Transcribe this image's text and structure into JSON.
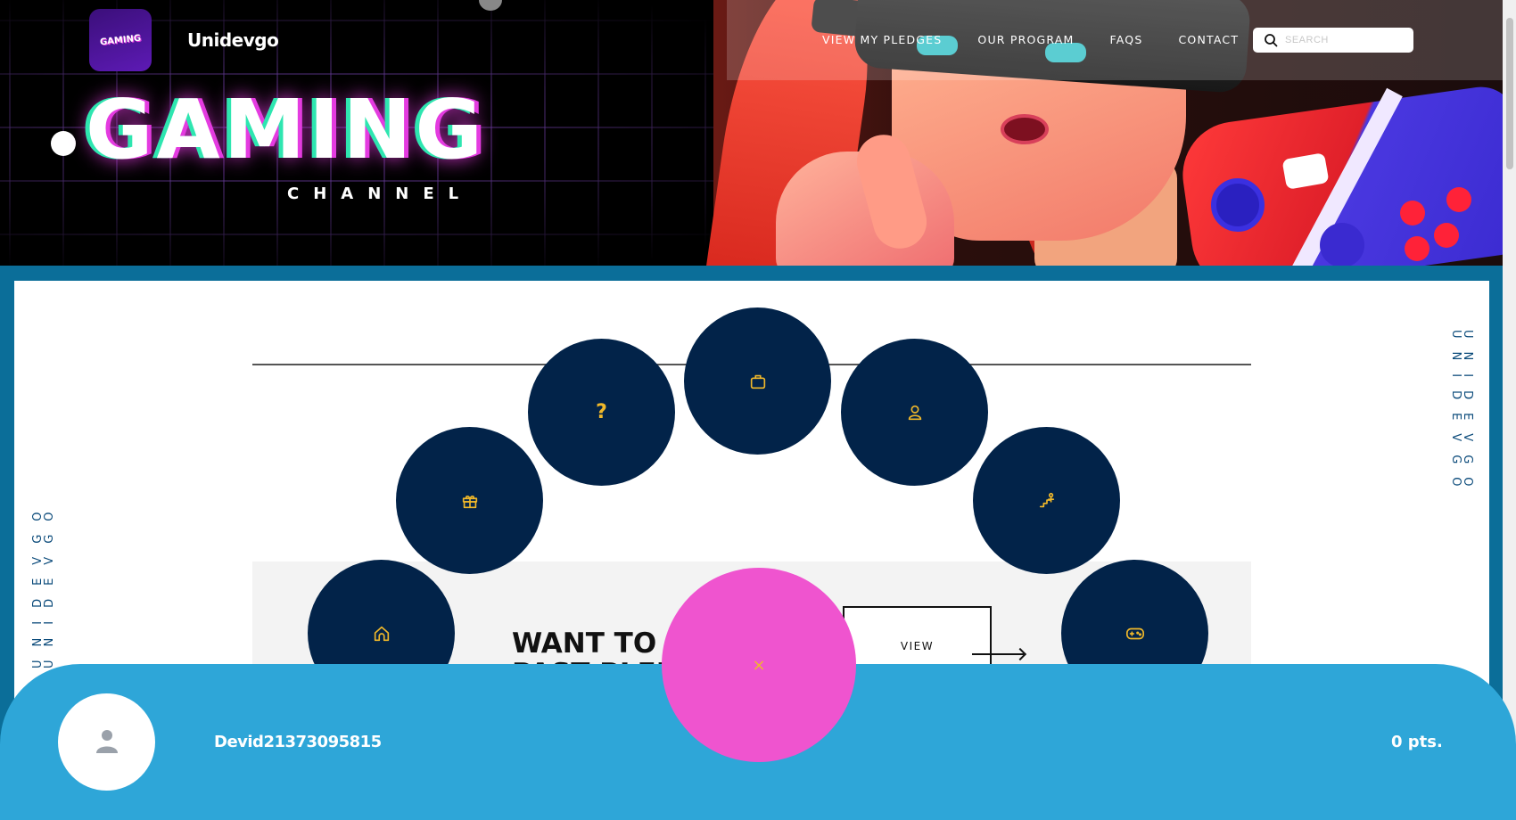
{
  "site": {
    "name": "Unidevgo",
    "logo_text": "GAMING"
  },
  "hero": {
    "title": "GAMING",
    "subtitle": "CHANNEL"
  },
  "nav": {
    "links": [
      "VIEW MY PLEDGES",
      "OUR PROGRAM",
      "FAQS",
      "CONTACT"
    ],
    "search_placeholder": "SEARCH"
  },
  "sidebar_text": {
    "left": "UNIDEVGO UNIDEVGO",
    "right": "UNIDEVGO UNIDEVGO"
  },
  "pledge": {
    "title_line1": "WANT TO S",
    "title_line2": "PAST PLEDGES",
    "view_label": "VIEW"
  },
  "radial_menu": {
    "items": [
      {
        "name": "home",
        "icon": "home-icon"
      },
      {
        "name": "gift",
        "icon": "gift-icon"
      },
      {
        "name": "help",
        "icon": "question-icon",
        "label": "?"
      },
      {
        "name": "shop",
        "icon": "bag-icon"
      },
      {
        "name": "profile",
        "icon": "user-icon"
      },
      {
        "name": "progress",
        "icon": "stairs-icon"
      },
      {
        "name": "games",
        "icon": "gamepad-icon"
      }
    ],
    "close_label": "×"
  },
  "user": {
    "username": "Devid21373095815",
    "points": "0 pts."
  },
  "colors": {
    "orb": "#022349",
    "icon": "#f0b82a",
    "close_orb": "#ef54cf",
    "bottom_bar": "#2ea6d8",
    "panel_border": "#0b6e99"
  }
}
